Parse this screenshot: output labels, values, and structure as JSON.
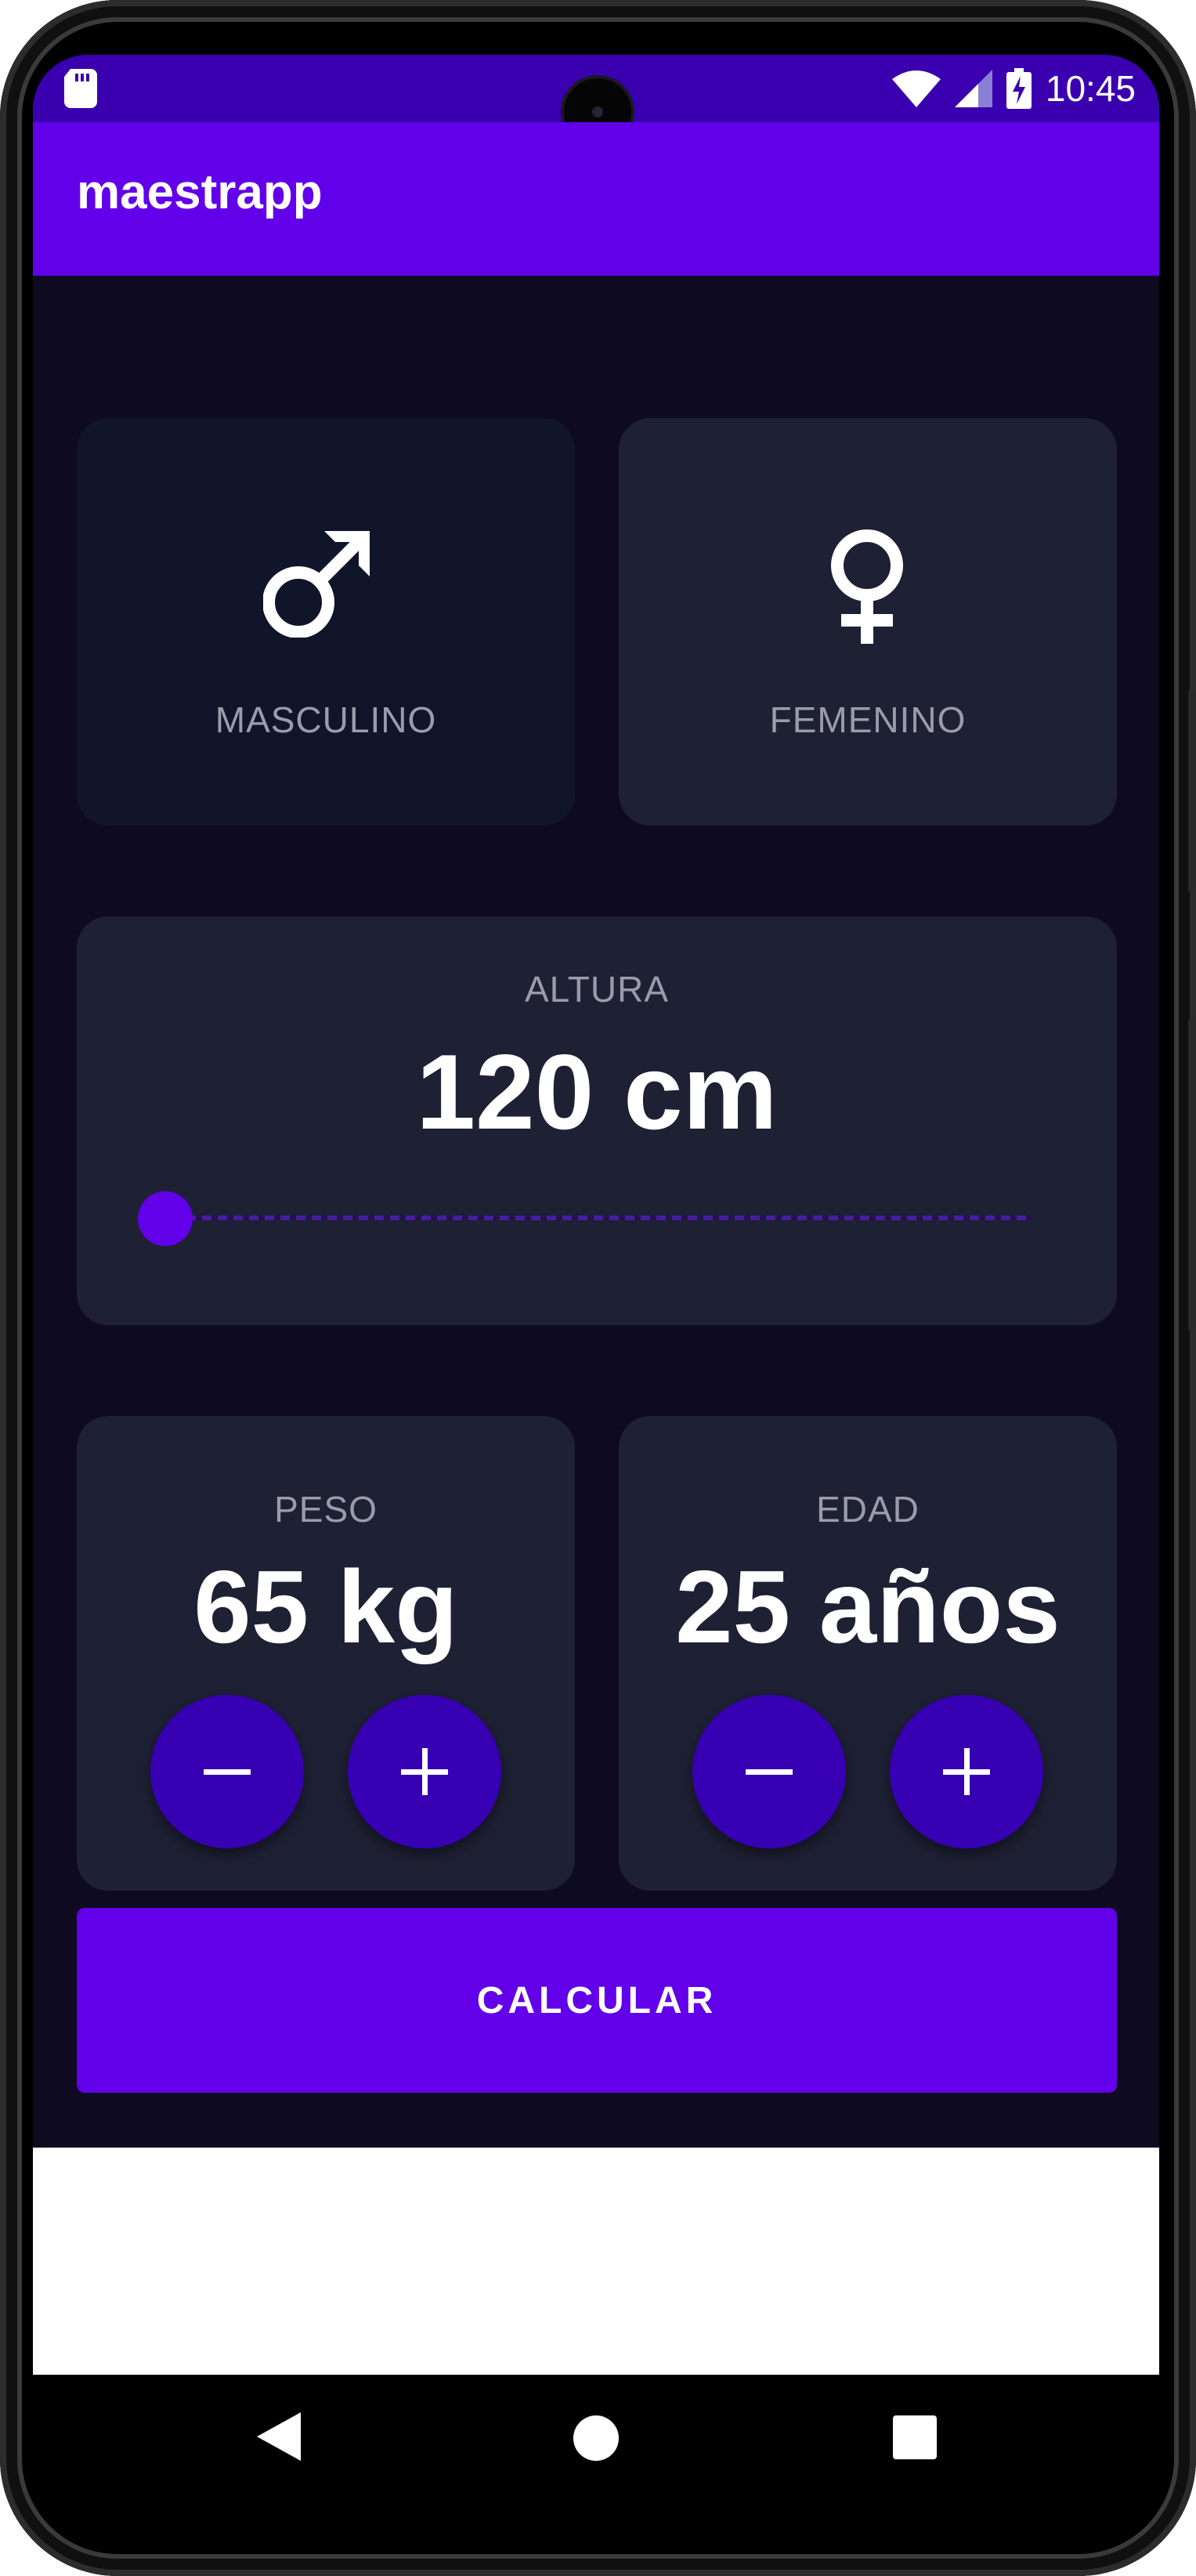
{
  "status_bar": {
    "time": "10:45",
    "icons": [
      "sd-card-icon",
      "wifi-icon",
      "signal-icon",
      "battery-charging-icon"
    ]
  },
  "app_bar": {
    "title": "maestrapp"
  },
  "gender": {
    "male_label": "MASCULINO",
    "female_label": "FEMENINO",
    "selected": "male"
  },
  "height": {
    "label": "ALTURA",
    "value_text": "120 cm",
    "slider_level": 0
  },
  "weight": {
    "label": "PESO",
    "value_text": "65 kg",
    "minus_icon": "minus-icon",
    "plus_icon": "plus-icon"
  },
  "age": {
    "label": "EDAD",
    "value_text": "25 años",
    "minus_icon": "minus-icon",
    "plus_icon": "plus-icon"
  },
  "calculate_button": {
    "label": "CALCULAR"
  },
  "colors": {
    "accent": "#6200ea",
    "status_bar": "#3a00b0",
    "background": "#0e0b21",
    "card": "#1e2034",
    "card_selected": "#11152a",
    "stepper_button": "#3700b3",
    "label_text": "#9a9caa"
  },
  "nav_bar": {
    "icons": [
      "back-icon",
      "home-icon",
      "recents-icon"
    ]
  }
}
